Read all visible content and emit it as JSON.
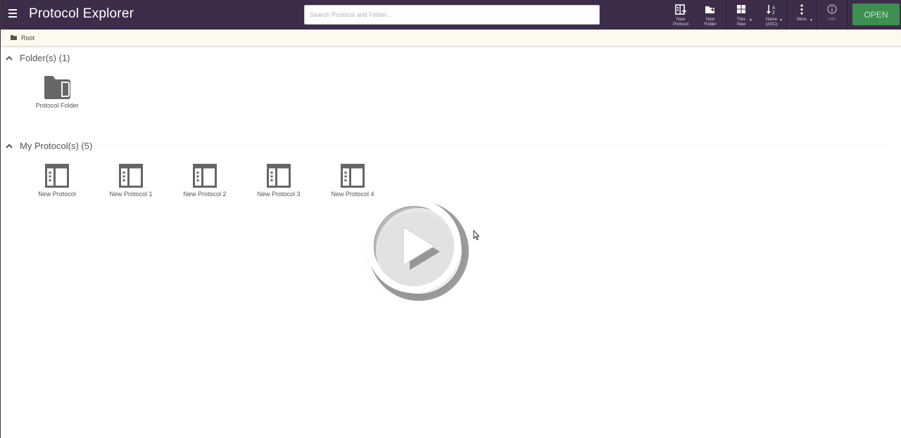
{
  "app": {
    "title": "Protocol Explorer"
  },
  "search": {
    "placeholder": "Search Protocol and Folder..."
  },
  "toolbar": {
    "new_protocol": {
      "line1": "New",
      "line2": "Protocol",
      "icon": "new-protocol-icon"
    },
    "new_folder": {
      "line1": "New",
      "line2": "Folder",
      "icon": "new-folder-icon"
    },
    "view": {
      "line1": "Tiles",
      "line2": "View",
      "icon": "tiles-view-icon"
    },
    "sort": {
      "line1": "Name",
      "line2": "(ASC)",
      "icon": "sort-az-icon"
    },
    "more": {
      "line1": "More",
      "icon": "more-vertical-icon"
    },
    "info": {
      "line1": "Info",
      "icon": "info-icon"
    },
    "open_label": "OPEN"
  },
  "breadcrumb": {
    "items": [
      "Root"
    ]
  },
  "sections": {
    "folders": {
      "title": "Folder(s) (1)",
      "items": [
        {
          "label": "Protocol Folder"
        }
      ]
    },
    "protocols": {
      "title": "My Protocol(s) (5)",
      "items": [
        {
          "label": "New Protocol"
        },
        {
          "label": "New Protocol 1"
        },
        {
          "label": "New Protocol 2"
        },
        {
          "label": "New Protocol 3"
        },
        {
          "label": "New Protocol 4"
        }
      ]
    }
  },
  "colors": {
    "topbar": "#3e2d48",
    "open_button": "#3f8f52",
    "breadcrumb_bg": "#fdf9ec",
    "icon_gray": "#666666"
  }
}
